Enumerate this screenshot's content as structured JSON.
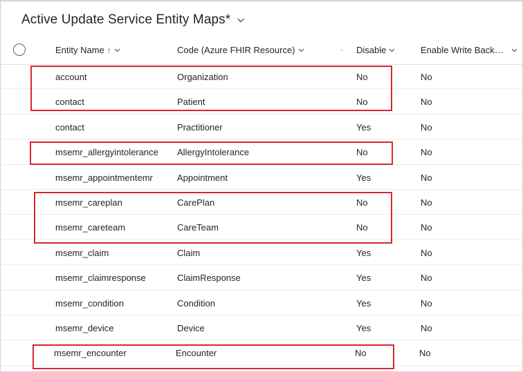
{
  "view": {
    "title": "Active Update Service Entity Maps*",
    "title_chevron_icon": "chevron-down-icon"
  },
  "columns": {
    "select_all_icon": "circle-checkbox-icon",
    "entity_name": "Entity Name",
    "entity_sort_glyph": "↑",
    "code": "Code (Azure FHIR Resource)",
    "disable": "Disable",
    "enable_write_back": "Enable Write Back t...",
    "chevron_icon": "chevron-down-icon"
  },
  "rows": [
    {
      "entity": "account",
      "code": "Organization",
      "disable": "No",
      "write_back": "No"
    },
    {
      "entity": "contact",
      "code": "Patient",
      "disable": "No",
      "write_back": "No"
    },
    {
      "entity": "contact",
      "code": "Practitioner",
      "disable": "Yes",
      "write_back": "No"
    },
    {
      "entity": "msemr_allergyintolerance",
      "code": "AllergyIntolerance",
      "disable": "No",
      "write_back": "No"
    },
    {
      "entity": "msemr_appointmentemr",
      "code": "Appointment",
      "disable": "Yes",
      "write_back": "No"
    },
    {
      "entity": "msemr_careplan",
      "code": "CarePlan",
      "disable": "No",
      "write_back": "No"
    },
    {
      "entity": "msemr_careteam",
      "code": "CareTeam",
      "disable": "No",
      "write_back": "No"
    },
    {
      "entity": "msemr_claim",
      "code": "Claim",
      "disable": "Yes",
      "write_back": "No"
    },
    {
      "entity": "msemr_claimresponse",
      "code": "ClaimResponse",
      "disable": "Yes",
      "write_back": "No"
    },
    {
      "entity": "msemr_condition",
      "code": "Condition",
      "disable": "Yes",
      "write_back": "No"
    },
    {
      "entity": "msemr_device",
      "code": "Device",
      "disable": "Yes",
      "write_back": "No"
    },
    {
      "entity": "msemr_encounter",
      "code": "Encounter",
      "disable": "No",
      "write_back": "No"
    }
  ],
  "colors": {
    "highlight_border": "#d9252c",
    "text": "#242424",
    "row_divider": "#ececec"
  }
}
